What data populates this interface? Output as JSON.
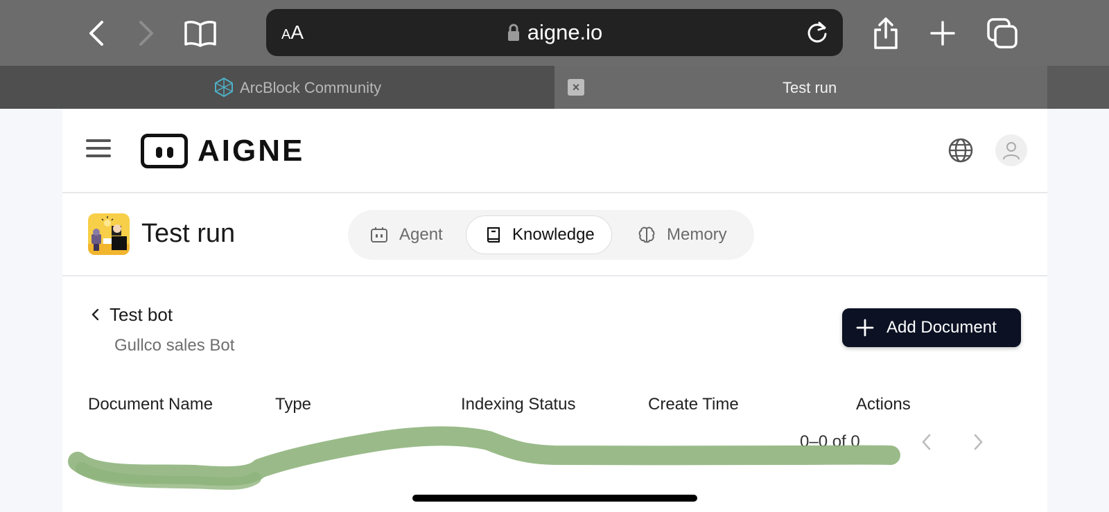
{
  "browser": {
    "text_size_button": {
      "small": "A",
      "large": "A"
    },
    "url": "aigne.io",
    "tabs": [
      {
        "label": "ArcBlock Community"
      },
      {
        "label": "Test run"
      }
    ]
  },
  "header": {
    "logo_text": "AIGNE"
  },
  "subbar": {
    "app_title": "Test run",
    "segments": [
      {
        "label": "Agent"
      },
      {
        "label": "Knowledge"
      },
      {
        "label": "Memory"
      }
    ],
    "active_segment": "Knowledge"
  },
  "knowledge": {
    "bot_name": "Test bot",
    "bot_description": "Gullco sales Bot",
    "add_button_label": "Add Document",
    "columns": [
      "Document Name",
      "Type",
      "Indexing Status",
      "Create Time",
      "Actions"
    ],
    "pagination": "0–0 of 0"
  },
  "colors": {
    "primary_button": "#0c1224",
    "scribble": "#8fb47c",
    "app_icon_bg": "#f7cf48"
  }
}
